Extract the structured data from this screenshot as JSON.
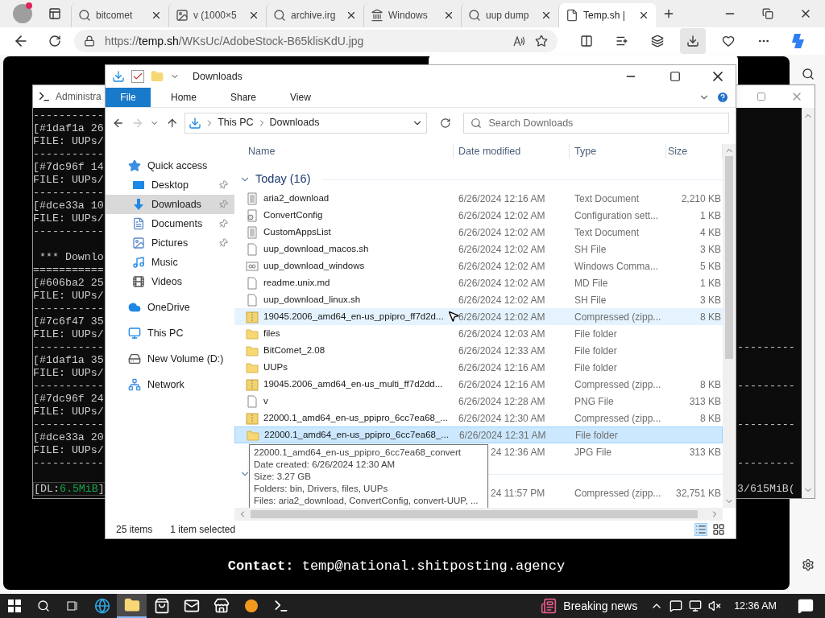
{
  "browser": {
    "tabs": [
      {
        "title": "bitcomet",
        "kind": "search",
        "selected": false
      },
      {
        "title": "v (1000×5",
        "kind": "thumb",
        "selected": false
      },
      {
        "title": "archive.irg",
        "kind": "search",
        "selected": false
      },
      {
        "title": "Windows",
        "kind": "museum",
        "selected": false
      },
      {
        "title": "uup dump",
        "kind": "search",
        "selected": false
      },
      {
        "title": "Temp.sh |",
        "kind": "page",
        "selected": true
      }
    ],
    "address": {
      "scheme": "https://",
      "host": "temp.sh",
      "path": "/WKsUc/AdobeStock-B65klisKdU.jpg"
    }
  },
  "console": {
    "title": "Administra",
    "rows": [
      {
        "text": "-----------"
      },
      {
        "text": "[#1daf1a 26"
      },
      {
        "text": "FILE: UUPs/"
      },
      {
        "text": "-----------"
      },
      {
        "text": "[#7dc96f 14"
      },
      {
        "text": "FILE: UUPs/"
      },
      {
        "text": "-----------"
      },
      {
        "text": "[#dce33a 10"
      },
      {
        "text": "FILE: UUPs/"
      },
      {
        "text": "-----------"
      },
      {},
      {
        "text": " *** Downlo"
      },
      {
        "text": "==========="
      },
      {
        "text": "[#606ba2 25"
      },
      {
        "text": "FILE: UUPs/"
      },
      {
        "text": "-----------"
      },
      {
        "text": "[#7c6f47 35"
      },
      {
        "text": "FILE: UUPs/"
      },
      {
        "text": "-----------",
        "right": "---------"
      },
      {
        "text": "[#1daf1a 35"
      },
      {
        "text": "FILE: UUPs/"
      },
      {
        "text": "-----------",
        "right": "---------"
      },
      {
        "text": "[#7dc96f 24"
      },
      {
        "text": "FILE: UUPs/"
      },
      {
        "text": "-----------",
        "right": "---------"
      },
      {
        "text": "[#dce33a 20"
      },
      {
        "text": "FILE: UUPs/"
      },
      {
        "text": "-----------",
        "right": "---------"
      },
      {},
      {
        "text": "[DL:",
        "accent": "6.5MiB",
        "tail": "]",
        "right": "3/615MiB("
      }
    ]
  },
  "explorer": {
    "title": "Downloads",
    "ribbon_tabs": [
      "File",
      "Home",
      "Share",
      "View"
    ],
    "nav_buttons": [
      {
        "kind": "back",
        "disabled": false
      },
      {
        "kind": "forward",
        "disabled": true
      },
      {
        "kind": "recent",
        "disabled": false
      },
      {
        "kind": "up",
        "disabled": false
      }
    ],
    "breadcrumb": [
      "This PC",
      "Downloads"
    ],
    "search": {
      "placeholder": "Search Downloads"
    },
    "nav_pane": [
      {
        "label": "Quick access",
        "kind": "star",
        "selected": false,
        "children": [
          {
            "label": "Desktop",
            "kind": "desktop",
            "selected": false,
            "pinned": true
          },
          {
            "label": "Downloads",
            "kind": "download",
            "selected": true,
            "pinned": true
          },
          {
            "label": "Documents",
            "kind": "document",
            "selected": false,
            "pinned": true
          },
          {
            "label": "Pictures",
            "kind": "pictures",
            "selected": false,
            "pinned": true
          },
          {
            "label": "Music",
            "kind": "music",
            "selected": false,
            "pinned": false
          },
          {
            "label": "Videos",
            "kind": "videos",
            "selected": false,
            "pinned": false
          }
        ]
      },
      {
        "label": "OneDrive",
        "kind": "cloud",
        "selected": false
      },
      {
        "label": "This PC",
        "kind": "pc",
        "selected": false
      },
      {
        "label": "New Volume (D:)",
        "kind": "drive",
        "selected": false
      },
      {
        "label": "Network",
        "kind": "network",
        "selected": false
      }
    ],
    "columns": [
      "Name",
      "Date modified",
      "Type",
      "Size"
    ],
    "groups": [
      {
        "label": "Today (16)",
        "rows": [
          {
            "name": "aria2_download",
            "kind": "text",
            "date": "6/26/2024 12:16 AM",
            "type": "Text Document",
            "size": "2,210 KB",
            "selected": false,
            "hovered": false
          },
          {
            "name": "ConvertConfig",
            "kind": "config",
            "date": "6/26/2024 12:02 AM",
            "type": "Configuration sett...",
            "size": "1 KB",
            "selected": false,
            "hovered": false
          },
          {
            "name": "CustomAppsList",
            "kind": "text",
            "date": "6/26/2024 12:02 AM",
            "type": "Text Document",
            "size": "4 KB",
            "selected": false,
            "hovered": false
          },
          {
            "name": "uup_download_macos.sh",
            "kind": "blank",
            "date": "6/26/2024 12:02 AM",
            "type": "SH File",
            "size": "3 KB",
            "selected": false,
            "hovered": false
          },
          {
            "name": "uup_download_windows",
            "kind": "cmd",
            "date": "6/26/2024 12:02 AM",
            "type": "Windows Comma...",
            "size": "5 KB",
            "selected": false,
            "hovered": false
          },
          {
            "name": "readme.unix.md",
            "kind": "blank",
            "date": "6/26/2024 12:02 AM",
            "type": "MD File",
            "size": "1 KB",
            "selected": false,
            "hovered": false
          },
          {
            "name": "uup_download_linux.sh",
            "kind": "blank",
            "date": "6/26/2024 12:02 AM",
            "type": "SH File",
            "size": "3 KB",
            "selected": false,
            "hovered": false
          },
          {
            "name": "19045.2006_amd64_en-us_ppipro_ff7d2d...",
            "kind": "zip",
            "date": "6/26/2024 12:02 AM",
            "type": "Compressed (zipp...",
            "size": "8 KB",
            "selected": false,
            "hovered": true
          },
          {
            "name": "files",
            "kind": "folder",
            "date": "6/26/2024 12:03 AM",
            "type": "File folder",
            "selected": false,
            "hovered": false
          },
          {
            "name": "BitComet_2.08",
            "kind": "folder",
            "date": "6/26/2024 12:33 AM",
            "type": "File folder",
            "selected": false,
            "hovered": false
          },
          {
            "name": "UUPs",
            "kind": "folder",
            "date": "6/26/2024 12:16 AM",
            "type": "File folder",
            "selected": false,
            "hovered": false
          },
          {
            "name": "19045.2006_amd64_en-us_multi_ff7d2dd...",
            "kind": "zip",
            "date": "6/26/2024 12:16 AM",
            "type": "Compressed (zipp...",
            "size": "8 KB",
            "selected": false,
            "hovered": false
          },
          {
            "name": "v",
            "kind": "blank",
            "date": "6/26/2024 12:28 AM",
            "type": "PNG File",
            "size": "313 KB",
            "selected": false,
            "hovered": false
          },
          {
            "name": "22000.1_amd64_en-us_ppipro_6cc7ea68_...",
            "kind": "zip",
            "date": "6/26/2024 12:30 AM",
            "type": "Compressed (zipp...",
            "size": "8 KB",
            "selected": false,
            "hovered": false
          },
          {
            "name": "22000.1_amd64_en-us_ppipro_6cc7ea68_...",
            "kind": "folder",
            "date": "6/26/2024 12:31 AM",
            "type": "File folder",
            "selected": true,
            "hovered": false
          },
          {
            "date": "24 12:36 AM",
            "type": "JPG File",
            "size": "313 KB",
            "selected": false,
            "hovered": false
          }
        ]
      },
      {
        "rows": [
          {
            "date": "24 11:57 PM",
            "type": "Compressed (zipp...",
            "size": "32,751 KB",
            "selected": false,
            "hovered": false
          }
        ]
      }
    ],
    "tooltip": [
      "22000.1_amd64_en-us_ppipro_6cc7ea68_convert",
      "Date created: 6/26/2024 12:30 AM",
      "Size: 3.27 GB",
      "Folders: bin, Drivers, files, UUPs",
      "Files: aria2_download, ConvertConfig, convert-UUP, ..."
    ],
    "status": {
      "count": "25 items",
      "selection": "1 item selected"
    }
  },
  "contact": "**Contact:** temp@national.shitposting.agency",
  "taskbar": {
    "apps": [
      {
        "kind": "edge",
        "active": false
      },
      {
        "kind": "explorer",
        "active": true
      },
      {
        "kind": "store",
        "active": false
      },
      {
        "kind": "mail",
        "active": false
      },
      {
        "kind": "shop",
        "active": false
      },
      {
        "kind": "ball",
        "active": false
      },
      {
        "kind": "cmd",
        "active": false
      }
    ],
    "news": "Breaking news",
    "time": "12:36 AM"
  }
}
